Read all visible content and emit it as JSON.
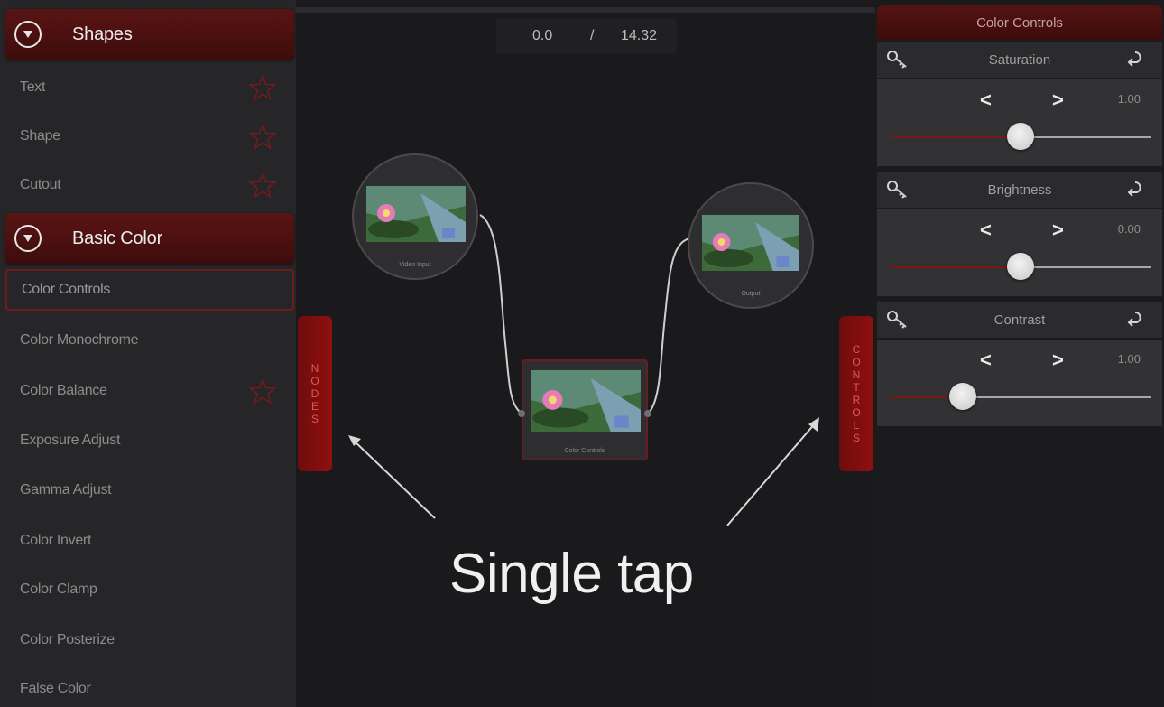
{
  "sidebar": {
    "sections": [
      {
        "title": "Shapes",
        "items": [
          "Text",
          "Shape",
          "Cutout"
        ]
      },
      {
        "title": "Basic Color",
        "items": [
          "Color Controls",
          "Color Monochrome",
          "Color Balance",
          "Exposure Adjust",
          "Gamma Adjust",
          "Color Invert",
          "Color Clamp",
          "Color Posterize",
          "False Color"
        ]
      }
    ],
    "selected_item": "Color Controls"
  },
  "timeline": {
    "current": "0.0",
    "separator": "/",
    "total": "14.32"
  },
  "tabs": {
    "nodes": "NODES",
    "controls": "CONTROLS"
  },
  "nodes": {
    "input_label": "Video Input",
    "filter_label": "Color Controls",
    "output_label": "Output"
  },
  "annotation": "Single tap",
  "controls": {
    "title": "Color Controls",
    "params": [
      {
        "name": "Saturation",
        "value": "1.00",
        "level": 0.5
      },
      {
        "name": "Brightness",
        "value": "0.00",
        "level": 0.5
      },
      {
        "name": "Contrast",
        "value": "1.00",
        "level": 0.28
      }
    ],
    "prev_label": "<",
    "next_label": ">"
  },
  "colors": {
    "accent": "#7a1717",
    "header": "#551313",
    "panel": "#262629"
  }
}
